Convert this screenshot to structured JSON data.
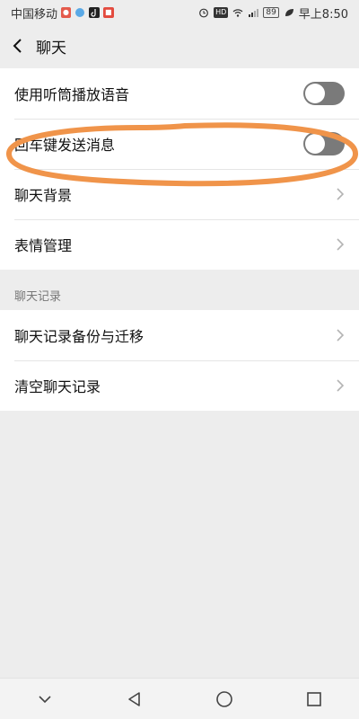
{
  "status_bar": {
    "carrier": "中国移动",
    "badge1": "HD",
    "badge2": "抖",
    "battery": "89",
    "time": "早上8:50"
  },
  "header": {
    "title": "聊天"
  },
  "settings": {
    "rows": [
      {
        "label": "使用听筒播放语音",
        "type": "toggle",
        "on": false
      },
      {
        "label": "回车键发送消息",
        "type": "toggle",
        "on": false
      },
      {
        "label": "聊天背景",
        "type": "nav"
      },
      {
        "label": "表情管理",
        "type": "nav"
      }
    ]
  },
  "history_section": {
    "title": "聊天记录",
    "rows": [
      {
        "label": "聊天记录备份与迁移",
        "type": "nav"
      },
      {
        "label": "清空聊天记录",
        "type": "nav"
      }
    ]
  },
  "colors": {
    "annotation": "#f0944a",
    "toggle_off": "#7a7a7a",
    "background": "#ededed"
  },
  "icons": {
    "back": "chevron-left-icon",
    "row_arrow": "chevron-right-icon",
    "nav_down": "chevron-down-icon",
    "nav_back": "triangle-back-icon",
    "nav_home": "circle-home-icon",
    "nav_recent": "square-recent-icon"
  }
}
